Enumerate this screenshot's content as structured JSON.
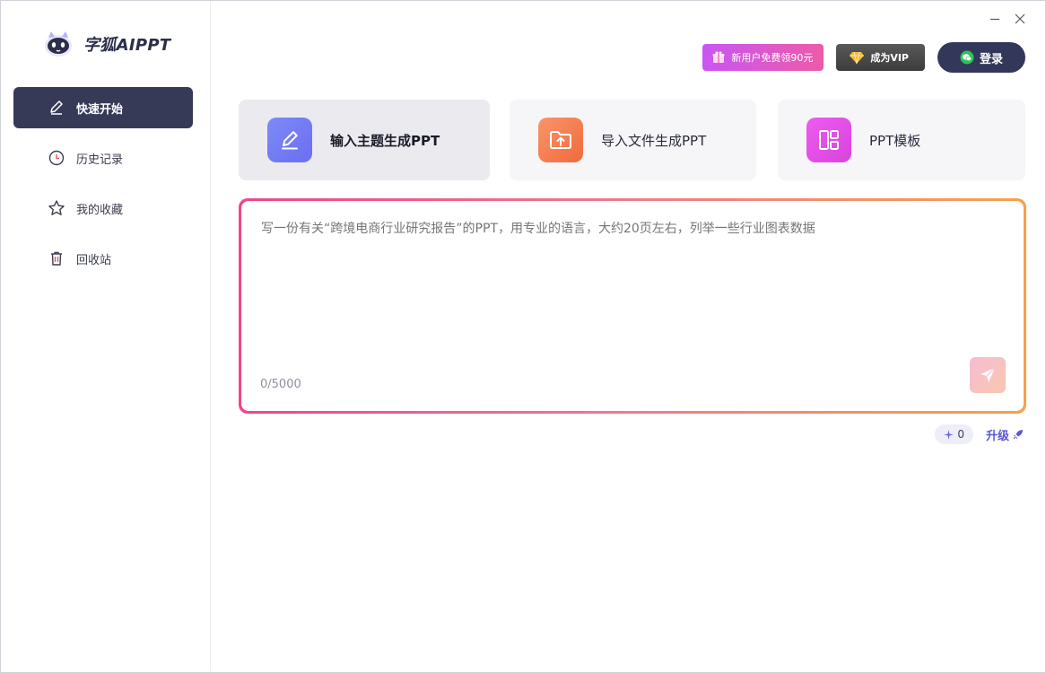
{
  "app": {
    "title": "字狐AIPPT"
  },
  "sidebar": {
    "items": [
      {
        "label": "快速开始",
        "icon": "pen-icon",
        "active": true
      },
      {
        "label": "历史记录",
        "icon": "clock-icon",
        "active": false
      },
      {
        "label": "我的收藏",
        "icon": "star-icon",
        "active": false
      },
      {
        "label": "回收站",
        "icon": "trash-icon",
        "active": false
      }
    ]
  },
  "header": {
    "gift_label": "新用户免费领90元",
    "vip_label": "成为VIP",
    "login_label": "登录"
  },
  "modes": [
    {
      "label": "输入主题生成PPT",
      "icon": "pen-icon",
      "color": "#6f7cf5",
      "selected": true
    },
    {
      "label": "导入文件生成PPT",
      "icon": "folder-upload-icon",
      "color": "#f47b4e",
      "selected": false
    },
    {
      "label": "PPT模板",
      "icon": "layout-icon",
      "color": "#e752e4",
      "selected": false
    }
  ],
  "prompt": {
    "placeholder": "写一份有关“跨境电商行业研究报告”的PPT，用专业的语言，大约20页左右，列举一些行业图表数据",
    "value": "",
    "char_count": "0/5000"
  },
  "credits": {
    "count": "0",
    "upgrade_label": "升级"
  },
  "colors": {
    "sidebar_active": "#373a57",
    "accent": "#5a57d6",
    "gradient_start": "#f0458c",
    "gradient_end": "#f7a04c"
  }
}
